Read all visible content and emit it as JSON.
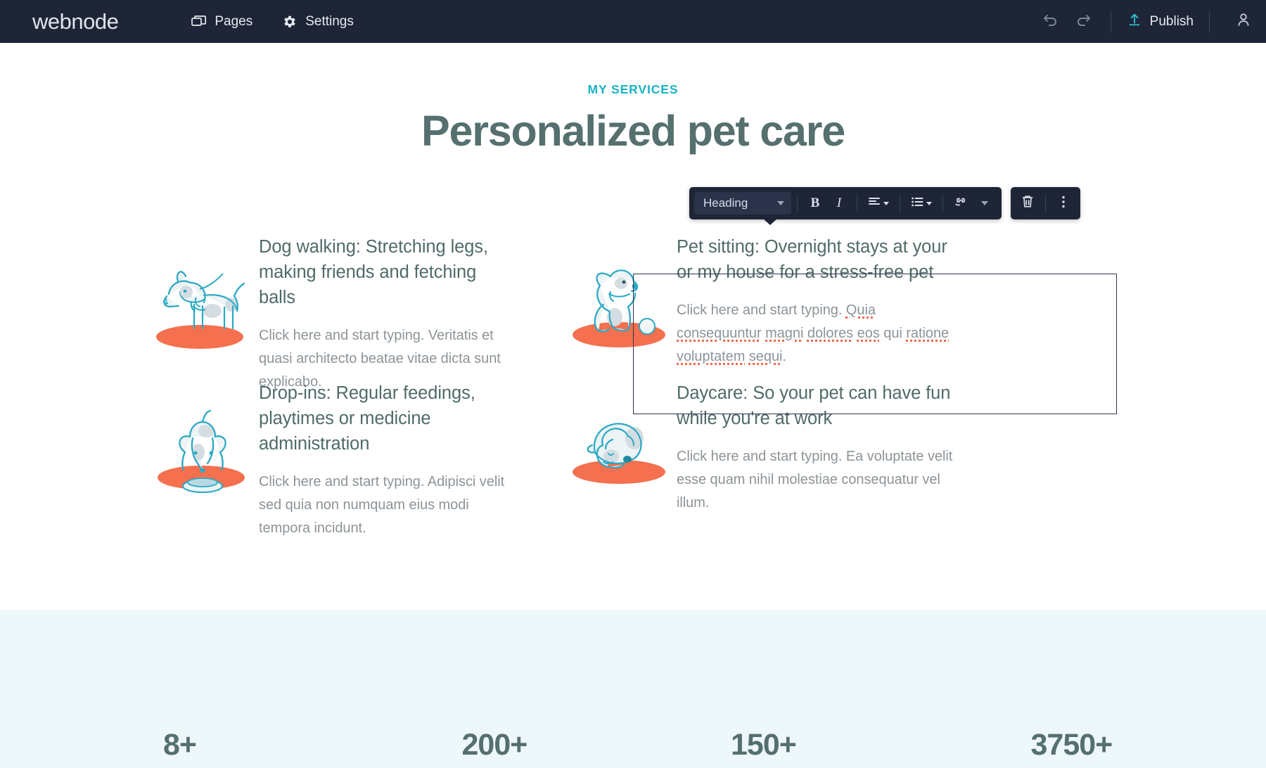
{
  "topbar": {
    "logo": "webnode",
    "nav": [
      {
        "label": "Pages",
        "icon": "pages-icon"
      },
      {
        "label": "Settings",
        "icon": "gear-icon"
      }
    ],
    "undo_icon": "undo-icon",
    "redo_icon": "redo-icon",
    "publish_label": "Publish",
    "publish_icon": "upload-icon",
    "account_icon": "user-icon",
    "bg_color": "#1e2536"
  },
  "editor_toolbar": {
    "style_select": "Heading",
    "bold_label": "B",
    "italic_label": "I",
    "align_icon": "align-left-icon",
    "list_icon": "bullet-list-icon",
    "link_icon": "link-icon",
    "more_caret_icon": "chevron-down-icon",
    "delete_icon": "trash-icon",
    "options_icon": "more-vertical-icon"
  },
  "page": {
    "eyebrow": "MY SERVICES",
    "eyebrow_color": "#19b3c6",
    "title": "Personalized pet care",
    "title_color": "#55706e"
  },
  "services": [
    {
      "illustration": "dog-walking-illustration",
      "title": "Dog walking: Stretching legs, making friends and fetching balls",
      "body_prefix": "Click here and start typing. Veritatis et quasi architecto beatae vitae dicta sunt explicabo.",
      "selected": false
    },
    {
      "illustration": "dog-sitting-illustration",
      "title": "Pet sitting: Overnight stays at your or my house for a stress-free pet",
      "body_prefix": "Click here and start typing. ",
      "body_spans": [
        {
          "text": "Quia",
          "misspelled": true
        },
        {
          "text": " ",
          "misspelled": false
        },
        {
          "text": "consequuntur",
          "misspelled": true
        },
        {
          "text": " ",
          "misspelled": false
        },
        {
          "text": "magni",
          "misspelled": true
        },
        {
          "text": " ",
          "misspelled": false
        },
        {
          "text": "dolores",
          "misspelled": true
        },
        {
          "text": " ",
          "misspelled": false
        },
        {
          "text": "eos",
          "misspelled": true
        },
        {
          "text": " qui ",
          "misspelled": false
        },
        {
          "text": "ratione",
          "misspelled": true
        },
        {
          "text": " ",
          "misspelled": false
        },
        {
          "text": "voluptatem",
          "misspelled": true
        },
        {
          "text": " ",
          "misspelled": false
        },
        {
          "text": "sequi",
          "misspelled": true
        },
        {
          "text": ".",
          "misspelled": false
        }
      ],
      "selected": true
    },
    {
      "illustration": "dog-eating-illustration",
      "title": "Drop-ins: Regular feedings, playtimes or medicine administration",
      "body_prefix": "Click here and start typing. Adipisci velit sed quia non numquam eius modi tempora incidunt.",
      "selected": false
    },
    {
      "illustration": "dog-sleeping-illustration",
      "title": "Daycare: So your pet can have fun while you're at work",
      "body_prefix": "Click here and start typing. Ea voluptate velit esse quam nihil molestiae consequatur vel illum.",
      "selected": false
    }
  ],
  "stats": {
    "background": "#eef8fa",
    "items": [
      {
        "value": "8+"
      },
      {
        "value": "200+"
      },
      {
        "value": "150+"
      },
      {
        "value": "3750+"
      }
    ]
  },
  "colors": {
    "accent_teal": "#19b3c6",
    "heading": "#55706e",
    "body_text": "#8c9499",
    "illustration_line": "#2aa9c4",
    "illustration_ground": "#f4704f",
    "spellcheck": "#ef6b4a"
  }
}
